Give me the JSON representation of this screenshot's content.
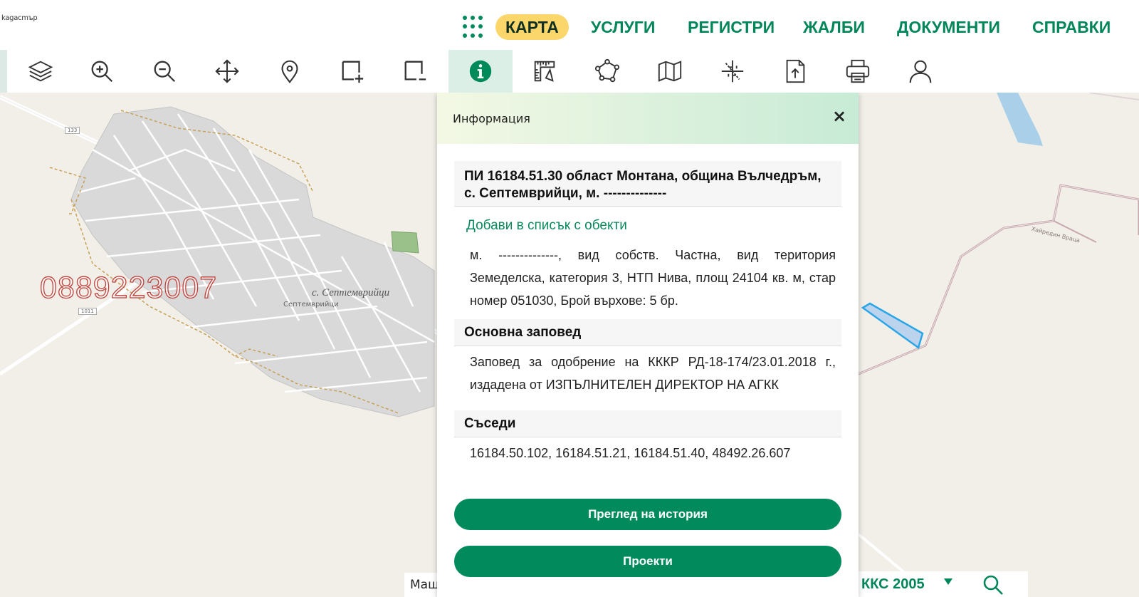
{
  "header": {
    "logo_text": "kagacmъp",
    "nav": [
      {
        "label": "КАРТА",
        "active": true
      },
      {
        "label": "УСЛУГИ"
      },
      {
        "label": "РЕГИСТРИ"
      },
      {
        "label": "ЖАЛБИ"
      },
      {
        "label": "ДОКУМЕНТИ"
      },
      {
        "label": "СПРАВКИ"
      }
    ],
    "accent_color": "#00865a",
    "active_pill_color": "#fbd76b"
  },
  "toolbar": {
    "tools": [
      "layers-icon",
      "zoom-in-icon",
      "zoom-out-icon",
      "pan-icon",
      "location-pin-icon",
      "rectangle-zoom-in-icon",
      "rectangle-zoom-out-icon",
      "info-icon",
      "measure-icon",
      "polygon-icon",
      "map-icon",
      "coordinates-icon",
      "upload-icon",
      "print-icon",
      "user-icon"
    ],
    "active_tool": "info-icon"
  },
  "map": {
    "watermark": "0889223007",
    "village_label": "с. Септемврийци",
    "village_sublabel": "Септемврийци",
    "road_badges": [
      "133",
      "1011"
    ],
    "area_label": "Хайредин  Враца"
  },
  "info_panel": {
    "title": "Информация",
    "close_symbol": "×",
    "object_title": "ПИ 16184.51.30 област Монтана, община Вълчедръм, с. Септемврийци, м. --------------",
    "add_link": "Добави в списък с обекти",
    "description": "м. --------------, вид собств. Частна, вид територия Земеделска, категория 3, НТП Нива, площ 24104 кв. м, стар номер 051030, Брой върхове: 5 бр.",
    "order_heading": "Основна заповед",
    "order_text": "Заповед за одобрение на КККР РД-18-174/23.01.2018 г., издадена от ИЗПЪЛНИТЕЛЕН ДИРЕКТОР НА АГКК",
    "neighbors_heading": "Съседи",
    "neighbors_text": "16184.50.102, 16184.51.21, 16184.51.40, 48492.26.607",
    "history_button": "Преглед на история",
    "projects_button": "Проекти"
  },
  "bottom_bar": {
    "scale_label": "Мащ",
    "crs_label": "ККС 2005"
  }
}
